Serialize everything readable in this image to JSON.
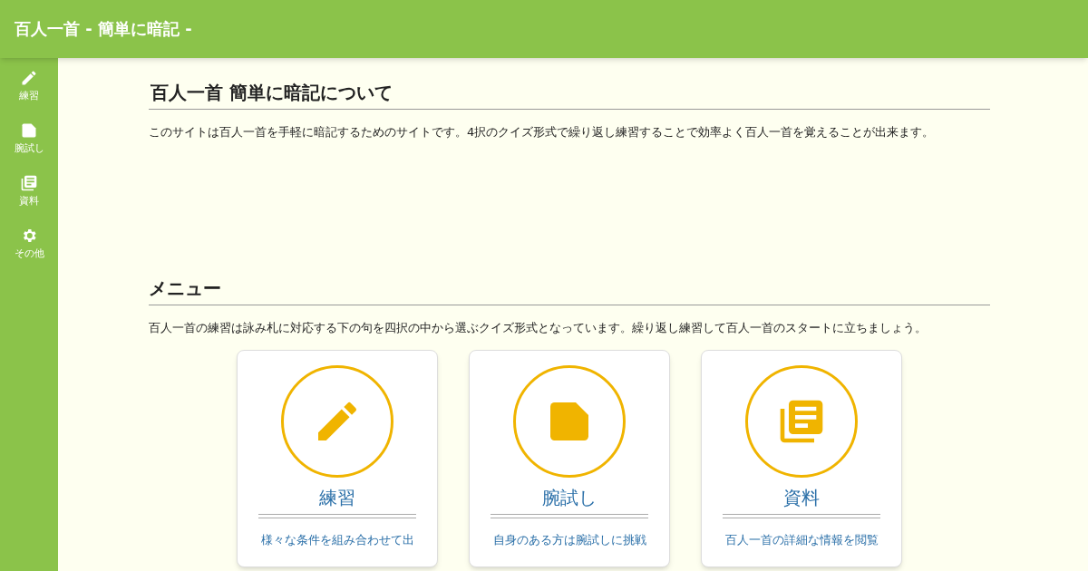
{
  "header": {
    "title": "百人一首 - 簡単に暗記 -"
  },
  "sidebar": {
    "items": [
      {
        "kind": "pencil",
        "label": "練習"
      },
      {
        "kind": "note",
        "label": "腕試し"
      },
      {
        "kind": "library",
        "label": "資料"
      },
      {
        "kind": "gear",
        "label": "その他"
      }
    ]
  },
  "about": {
    "heading": "百人一首 簡単に暗記について",
    "text": "このサイトは百人一首を手軽に暗記するためのサイトです。4択のクイズ形式で繰り返し練習することで効率よく百人一首を覚えることが出来ます。"
  },
  "menu": {
    "heading": "メニュー",
    "text": "百人一首の練習は詠み札に対応する下の句を四択の中から選ぶクイズ形式となっています。繰り返し練習して百人一首のスタートに立ちましょう。",
    "cards": [
      {
        "kind": "pencil",
        "title": "練習",
        "description": "様々な条件を組み合わせて出"
      },
      {
        "kind": "note",
        "title": "腕試し",
        "description": "自身のある方は腕試しに挑戦"
      },
      {
        "kind": "library",
        "title": "資料",
        "description": "百人一首の詳細な情報を閲覧"
      }
    ]
  }
}
